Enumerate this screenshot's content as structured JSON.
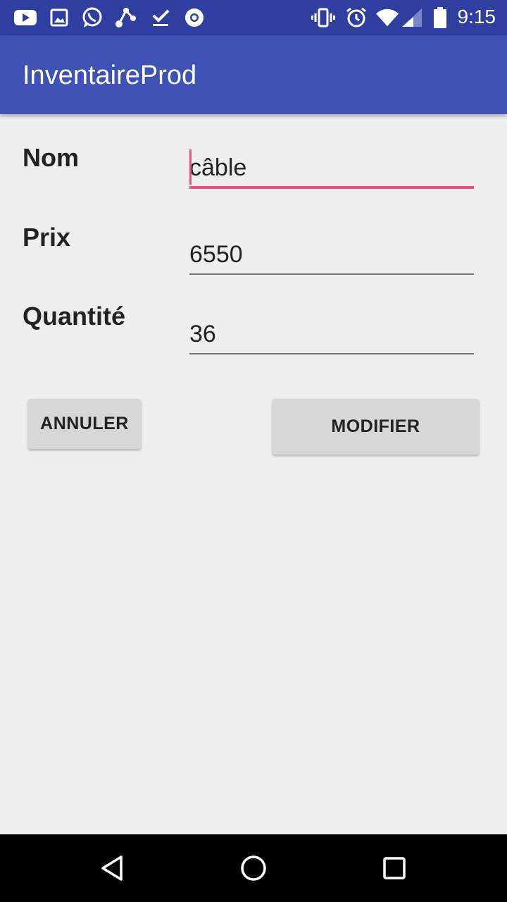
{
  "status_bar": {
    "time": "9:15",
    "left_icons": [
      "youtube-icon",
      "image-icon",
      "whatsapp-icon",
      "share-icon",
      "download-done-icon",
      "chrome-icon"
    ],
    "right_icons": [
      "vibrate-icon",
      "alarm-icon",
      "wifi-icon",
      "signal-icon",
      "battery-icon"
    ]
  },
  "app_bar": {
    "title": "InventaireProd"
  },
  "form": {
    "nom": {
      "label": "Nom",
      "value": "câble"
    },
    "prix": {
      "label": "Prix",
      "value": "6550"
    },
    "quantite": {
      "label": "Quantité",
      "value": "36"
    }
  },
  "buttons": {
    "cancel": "ANNULER",
    "modify": "MODIFIER"
  },
  "nav_bar": {
    "icons": [
      "back-icon",
      "home-icon",
      "recents-icon"
    ]
  },
  "colors": {
    "status_bar": "#303f9f",
    "app_bar": "#3f51b5",
    "accent": "#e94f84",
    "background": "#eeeeee",
    "button": "#d6d7d7"
  }
}
